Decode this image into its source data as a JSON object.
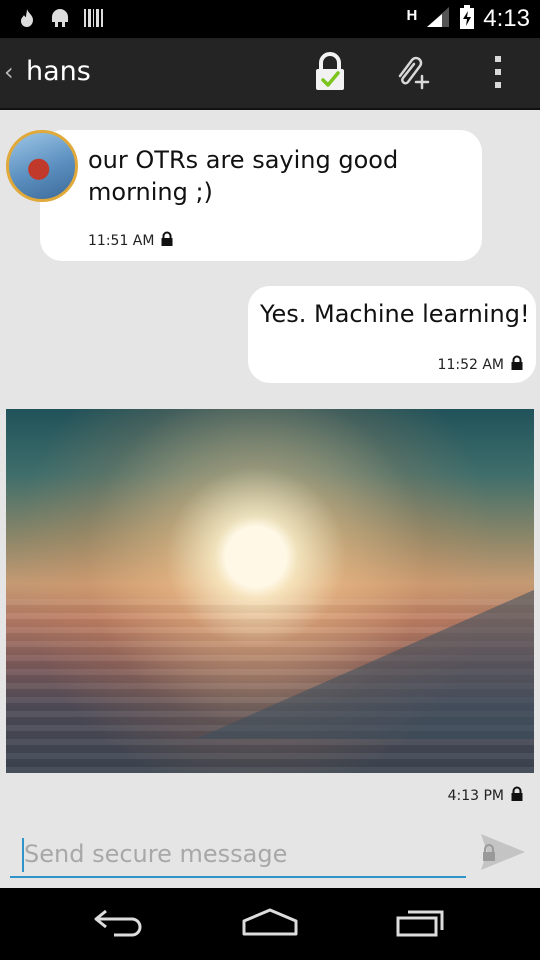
{
  "status_bar": {
    "network_type": "H",
    "time": "4:13",
    "left_icons": [
      "flame-notification-icon",
      "android-notification-icon",
      "barcode-notification-icon"
    ]
  },
  "action_bar": {
    "contact_name": "hans",
    "icons": [
      "back-chevron-icon",
      "otr-verified-lock-icon",
      "attach-file-icon",
      "overflow-menu-icon"
    ]
  },
  "messages": [
    {
      "direction": "incoming",
      "text": "our OTRs are saying good morning ;)",
      "time": "11:51 AM",
      "encrypted_icon": "lock-icon"
    },
    {
      "direction": "outgoing",
      "text": "Yes. Machine learning!",
      "time": "11:52 AM",
      "encrypted_icon": "lock-icon"
    },
    {
      "direction": "outgoing",
      "type": "image",
      "image_description": "sunrise-over-clouds-photo",
      "time": "4:13 PM",
      "encrypted_icon": "lock-icon"
    }
  ],
  "compose": {
    "placeholder": "Send secure message",
    "value": ""
  },
  "colors": {
    "accent": "#2f95c9",
    "action_bar": "#242424",
    "background": "#e5e5e5",
    "bubble": "#ffffff",
    "otr_check": "#7cc41e"
  }
}
